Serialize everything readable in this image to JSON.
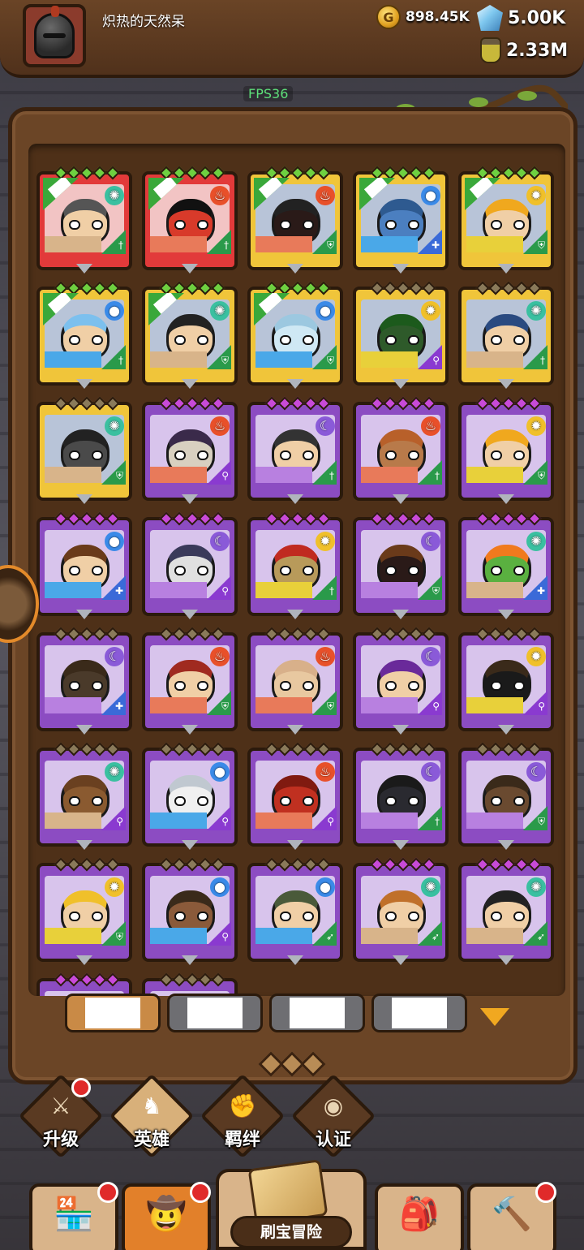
{
  "player": {
    "name": "炽热的天然呆"
  },
  "resources": {
    "gold": "898.45K",
    "gems": "5.00K",
    "potion": "2.33M"
  },
  "fps": "FPS36",
  "colors": {
    "red": "#e23a3a",
    "gold": "#f0c53a",
    "purple": "#8c4cc2",
    "accent": "#e2802a"
  },
  "heroes": [
    {
      "frame": "red",
      "element": "wind-icon",
      "role": "sword-icon",
      "star": "green",
      "ribbon": true,
      "skin": "#f0cfa6",
      "hair": "#555"
    },
    {
      "frame": "red",
      "element": "fire-icon",
      "role": "sword-icon",
      "star": "green",
      "ribbon": true,
      "skin": "#d83a2a",
      "hair": "#111"
    },
    {
      "frame": "gold",
      "element": "fire-icon",
      "role": "shield-icon",
      "star": "green",
      "ribbon": true,
      "skin": "#2a1a18",
      "hair": "#222"
    },
    {
      "frame": "gold",
      "element": "water-icon",
      "role": "dagger-icon",
      "star": "green",
      "ribbon": true,
      "skin": "#4b7fc0",
      "hair": "#2e5a90"
    },
    {
      "frame": "gold",
      "element": "light-icon",
      "role": "shield-icon",
      "star": "green",
      "ribbon": true,
      "skin": "#f0cfa6",
      "hair": "#f0a81e"
    },
    {
      "frame": "gold",
      "element": "water-icon",
      "role": "sword-icon",
      "star": "green",
      "ribbon": true,
      "skin": "#f0cfa6",
      "hair": "#7cc0ee"
    },
    {
      "frame": "gold",
      "element": "wind-icon",
      "role": "shield-icon",
      "star": "green",
      "ribbon": true,
      "skin": "#f0cfa6",
      "hair": "#222"
    },
    {
      "frame": "gold",
      "element": "water-icon",
      "role": "shield-icon",
      "star": "green",
      "ribbon": true,
      "skin": "#cfe8f4",
      "hair": "#9cc8e0"
    },
    {
      "frame": "gold",
      "element": "light-icon",
      "role": "staff-icon",
      "star": "gold",
      "ribbon": false,
      "skin": "#2e5a2a",
      "hair": "#1c5a1c"
    },
    {
      "frame": "gold",
      "element": "wind-icon",
      "role": "sword-icon",
      "star": "gold",
      "ribbon": false,
      "skin": "#f0cfa6",
      "hair": "#2a4a80"
    },
    {
      "frame": "gold",
      "element": "wind-icon",
      "role": "shield-icon",
      "star": "gold",
      "ribbon": false,
      "skin": "#4a4a4a",
      "hair": "#222"
    },
    {
      "frame": "purple",
      "element": "fire-icon",
      "role": "staff-icon",
      "star": "purple",
      "ribbon": false,
      "skin": "#d8d0c0",
      "hair": "#3a2a4a"
    },
    {
      "frame": "purple",
      "element": "moon-icon",
      "role": "sword-icon",
      "star": "purple",
      "ribbon": false,
      "skin": "#f0cfa6",
      "hair": "#333"
    },
    {
      "frame": "purple",
      "element": "fire-icon",
      "role": "sword-icon",
      "star": "purple",
      "ribbon": false,
      "skin": "#b87a4a",
      "hair": "#b8602a"
    },
    {
      "frame": "purple",
      "element": "light-icon",
      "role": "shield-icon",
      "star": "purple",
      "ribbon": false,
      "skin": "#f0cfa6",
      "hair": "#f0a81e"
    },
    {
      "frame": "purple",
      "element": "water-icon",
      "role": "dagger-icon",
      "star": "purple",
      "ribbon": false,
      "skin": "#f0cfa6",
      "hair": "#6a3a1a"
    },
    {
      "frame": "purple",
      "element": "moon-icon",
      "role": "staff-icon",
      "star": "purple",
      "ribbon": false,
      "skin": "#e0e0e0",
      "hair": "#3a3a5a"
    },
    {
      "frame": "purple",
      "element": "light-icon",
      "role": "sword-icon",
      "star": "purple",
      "ribbon": false,
      "skin": "#b89a5a",
      "hair": "#c02a20"
    },
    {
      "frame": "purple",
      "element": "moon-icon",
      "role": "shield-icon",
      "star": "purple",
      "ribbon": false,
      "skin": "#2a1a18",
      "hair": "#6a3a1a"
    },
    {
      "frame": "purple",
      "element": "wind-icon",
      "role": "dagger-icon",
      "star": "purple",
      "ribbon": false,
      "skin": "#5ab040",
      "hair": "#f07a1e"
    },
    {
      "frame": "purple",
      "element": "moon-icon",
      "role": "dagger-icon",
      "star": "gold",
      "ribbon": false,
      "skin": "#4a3a2a",
      "hair": "#3a2a1a"
    },
    {
      "frame": "purple",
      "element": "fire-icon",
      "role": "shield-icon",
      "star": "gold",
      "ribbon": false,
      "skin": "#f0cfa6",
      "hair": "#a02a20"
    },
    {
      "frame": "purple",
      "element": "fire-icon",
      "role": "shield-icon",
      "star": "gold",
      "ribbon": false,
      "skin": "#e8c8a0",
      "hair": "#d8b08a"
    },
    {
      "frame": "purple",
      "element": "moon-icon",
      "role": "staff-icon",
      "star": "gold",
      "ribbon": false,
      "skin": "#f0cfa6",
      "hair": "#6a2a9a"
    },
    {
      "frame": "purple",
      "element": "light-icon",
      "role": "staff-icon",
      "star": "gold",
      "ribbon": false,
      "skin": "#1a1a1a",
      "hair": "#3a2a1a"
    },
    {
      "frame": "purple",
      "element": "wind-icon",
      "role": "staff-icon",
      "star": "gold",
      "ribbon": false,
      "skin": "#8a5a30",
      "hair": "#6a4020"
    },
    {
      "frame": "purple",
      "element": "water-icon",
      "role": "staff-icon",
      "star": "gold",
      "ribbon": false,
      "skin": "#f0f0f0",
      "hair": "#c0c8d0"
    },
    {
      "frame": "purple",
      "element": "fire-icon",
      "role": "staff-icon",
      "star": "gold",
      "ribbon": false,
      "skin": "#c03020",
      "hair": "#801a10"
    },
    {
      "frame": "purple",
      "element": "moon-icon",
      "role": "sword-icon",
      "star": "gold",
      "ribbon": false,
      "skin": "#2a2a30",
      "hair": "#1a1a1a"
    },
    {
      "frame": "purple",
      "element": "moon-icon",
      "role": "shield-icon",
      "star": "gold",
      "ribbon": false,
      "skin": "#6a4a30",
      "hair": "#3a2a1a"
    },
    {
      "frame": "purple",
      "element": "light-icon",
      "role": "shield-icon",
      "star": "gold",
      "ribbon": false,
      "skin": "#f0cfa6",
      "hair": "#f0c02a"
    },
    {
      "frame": "purple",
      "element": "water-icon",
      "role": "staff-icon",
      "star": "gold",
      "ribbon": false,
      "skin": "#8a5a3a",
      "hair": "#3a2a1a"
    },
    {
      "frame": "purple",
      "element": "water-icon",
      "role": "bow-icon",
      "star": "gold",
      "ribbon": false,
      "skin": "#f0cfa6",
      "hair": "#4a5a3a"
    },
    {
      "frame": "purple",
      "element": "wind-icon",
      "role": "bow-icon",
      "star": "purple",
      "ribbon": false,
      "skin": "#f0cfa6",
      "hair": "#c0702a"
    },
    {
      "frame": "purple",
      "element": "wind-icon",
      "role": "bow-icon",
      "star": "purple",
      "ribbon": false,
      "skin": "#f0cfa6",
      "hair": "#222"
    },
    {
      "frame": "purple",
      "element": "",
      "role": "",
      "star": "purple",
      "ribbon": false,
      "skin": "#d8c4ec",
      "hair": "#d8c4ec"
    },
    {
      "frame": "purple",
      "element": "",
      "role": "",
      "star": "gold",
      "ribbon": false,
      "skin": "#d8c4ec",
      "hair": "#d8c4ec"
    }
  ],
  "tabs": [
    "",
    "",
    "",
    ""
  ],
  "subnav": [
    {
      "label": "升级",
      "icon": "sword-icon",
      "badge": true
    },
    {
      "label": "英雄",
      "icon": "hero-icon",
      "badge": false
    },
    {
      "label": "羁绊",
      "icon": "fist-icon",
      "badge": false
    },
    {
      "label": "认证",
      "icon": "eye-icon",
      "badge": false
    }
  ],
  "bottom_nav": {
    "shop": {
      "icon": "shop-icon",
      "badge": true
    },
    "heroes": {
      "icon": "hero-avatar-icon",
      "badge": true
    },
    "adventure": {
      "label": "刷宝冒险",
      "icon": "treasure-map-icon"
    },
    "bag": {
      "icon": "backpack-icon"
    },
    "forge": {
      "icon": "hammer-icon",
      "badge": true
    }
  }
}
